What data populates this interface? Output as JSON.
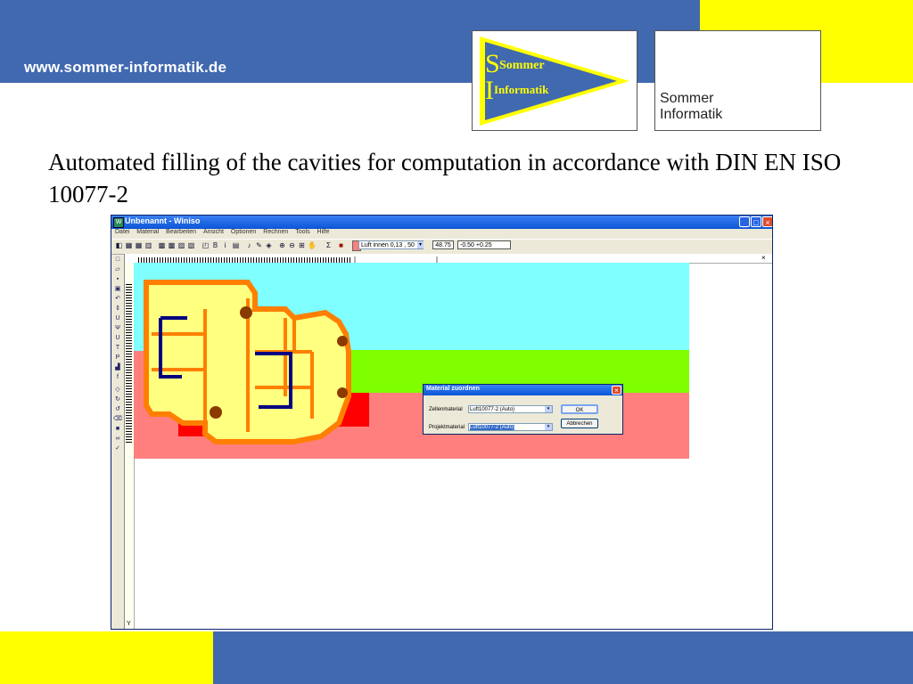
{
  "slide": {
    "url": "www.sommer-informatik.de",
    "logo_left": {
      "line1": "Sommer",
      "line2": "Informatik"
    },
    "logo_right": {
      "text": "Sommer\nInformatik"
    },
    "headline": "Automated filling of the cavities for computation in accordance with DIN EN ISO 10077-2"
  },
  "colors": {
    "frame_blue": "#4169b0",
    "frame_yellow": "#ffff00",
    "air_cyan": "#7fffff",
    "glass_green": "#7fff00",
    "insert_red": "#ff0000",
    "wall_pink": "#ff7f7f",
    "profile_yellow": "#ffff80",
    "profile_orange": "#ff7f00",
    "steel_blue": "#000080"
  },
  "window": {
    "title": "Unbenannt - Winiso",
    "menu": [
      "Datei",
      "Material",
      "Bearbeiten",
      "Ansicht",
      "Optionen",
      "Rechnen",
      "Tools",
      "Hilfe"
    ],
    "toolbar": {
      "material_select": "Luft innen 0,13 , 50",
      "value_1": "48.75",
      "value_2": "-0.50    +0.25"
    },
    "canvas_close": "×",
    "ruler_marker": "Y"
  },
  "dialog": {
    "title": "Material zuordnen",
    "cell_label": "Zellenmaterial",
    "cell_value": "Luft10077-2 (Auto)",
    "project_label": "Projektmaterial",
    "project_value": "Luft10077-2 (Auto)",
    "ok": "OK",
    "cancel": "Abbrechen"
  }
}
